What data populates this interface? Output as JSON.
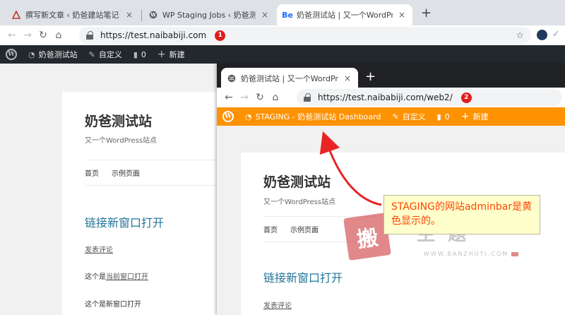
{
  "back_window": {
    "tabs": [
      {
        "title": "撰写新文章 ‹ 奶爸建站笔记 — W",
        "icon": "tab-favicon-icon"
      },
      {
        "title": "WP Staging Jobs ‹ 奶爸测试站",
        "icon": "wordpress-icon"
      },
      {
        "title": "奶爸测试站 | 又一个WordPress站",
        "icon": "behance-icon",
        "favicon_text": "Be"
      }
    ],
    "close_glyph": "×",
    "newtab_glyph": "+",
    "url": "https://test.naibabiji.com",
    "badge": "1",
    "adminbar": {
      "site": "奶爸测试站",
      "customize": "自定义",
      "comments": "0",
      "new": "新建"
    },
    "page": {
      "site_title": "奶爸测试站",
      "site_desc": "又一个WordPress站点",
      "menu": [
        "首页",
        "示例页面"
      ],
      "post_title": "链接新窗口打开",
      "comment_link": "发表评论",
      "line1_prefix": "这个是",
      "line1_link": "当前窗口打开",
      "line2": "这个是新窗口打开"
    }
  },
  "front_window": {
    "tab_title": "奶爸测试站 | 又一个WordPress站",
    "close_glyph": "×",
    "newtab_glyph": "+",
    "url": "https://test.naibabiji.com/web2/",
    "badge": "2",
    "adminbar": {
      "site": "STAGING - 奶爸测试站 Dashboard",
      "customize": "自定义",
      "comments": "0",
      "new": "新建",
      "color": "#ff9200"
    },
    "page": {
      "site_title": "奶爸测试站",
      "site_desc": "又一个WordPress站点",
      "menu": [
        "首页",
        "示例页面"
      ],
      "post_title": "链接新窗口打开",
      "comment_link": "发表评论"
    }
  },
  "annotation": {
    "text": "STAGING的网站adminbar是黄色显示的。"
  },
  "watermark": {
    "stamp": "搬",
    "text": "主题",
    "url": "WWW.BANZHUTI.COM"
  }
}
